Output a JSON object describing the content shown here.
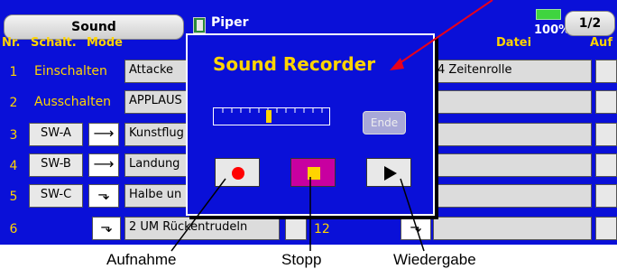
{
  "header": {
    "tab_label": "Sound",
    "model_name": "Piper",
    "battery": "100%",
    "page": "1/2"
  },
  "columns": {
    "nr": "Nr.",
    "schalt": "Schalt.",
    "mode": "Mode",
    "datei": "Datei",
    "auf": "Auf"
  },
  "rows": [
    {
      "nr": "1",
      "switch": "Einschalten",
      "sound": "Attacke",
      "file": "4 Zeitenrolle"
    },
    {
      "nr": "2",
      "switch": "Ausschalten",
      "sound": "APPLAUS",
      "file": ""
    },
    {
      "nr": "3",
      "switch": "SW-A",
      "sound": "Kunstflug",
      "file": ""
    },
    {
      "nr": "4",
      "switch": "SW-B",
      "sound": "Landung",
      "file": ""
    },
    {
      "nr": "5",
      "switch": "SW-C",
      "sound": "Halbe un",
      "file": ""
    },
    {
      "nr": "6",
      "switch": "",
      "sound": "2 UM Rückentrudeln",
      "file": "12"
    }
  ],
  "recorder": {
    "title": "Sound Recorder",
    "end_button": "Ende",
    "record_color": "#ff0000",
    "stop_color": "#ffd400",
    "stop_bg": "#c800a0",
    "slider_marker_color": "#ffd400"
  },
  "labels": {
    "record": "Aufnahme",
    "stop": "Stopp",
    "play": "Wiedergabe"
  },
  "colors": {
    "background": "#0a10d8",
    "text_yellow": "#ffd400",
    "callout_arrow": "#e8001c"
  }
}
